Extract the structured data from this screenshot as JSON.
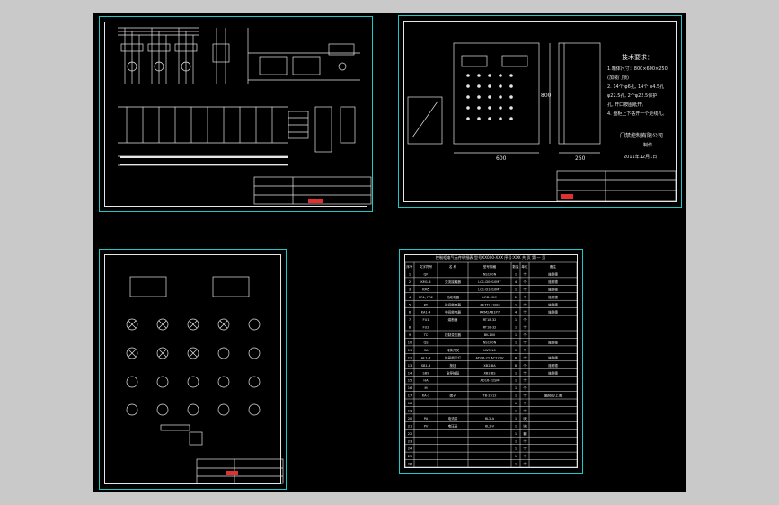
{
  "colors": {
    "background": "#c9c9c9",
    "canvas": "#000000",
    "sheet_border": "#1fc7c7",
    "line": "#e6e6e6",
    "accent_red": "#e03030"
  },
  "sheet2": {
    "notes_title": "技术要求：",
    "notes": [
      "1.箱体尺寸：800×600×250",
      "  (加装门锁)",
      "2. 14个 φ6孔, 14个 φ4.5孔",
      "  φ22.5孔, 2个φ22.5保护",
      "  孔, 开口按图纸开。",
      "4. 盘柜上下各开一个走线孔。"
    ],
    "company": "门禁控制有限公司",
    "author": "制作",
    "date": "2011年12月1日",
    "dim_width": "600",
    "dim_height": "800",
    "dim_depth": "250"
  },
  "sheet4": {
    "title": "控制柜电气元件明细表 型号XX000-XXX 序号:XXX 共 页 第 一 页",
    "header": [
      "序号",
      "文字符号",
      "名 称",
      "型号规格",
      "数量",
      "单位",
      "备注"
    ],
    "rows": [
      [
        "1",
        "QF",
        "",
        "NS100N",
        "1",
        "个",
        "施耐德"
      ],
      [
        "2",
        "KM1-4",
        "交流接触器",
        "LC1-D0910M7",
        "4",
        "个",
        "施耐德"
      ],
      [
        "3",
        "KM5",
        "",
        "LC1-D1810M7",
        "1",
        "个",
        "施耐德"
      ],
      [
        "4",
        "FR1, FR2",
        "热继电器",
        "LRD-22C",
        "2",
        "个",
        "施耐德"
      ],
      [
        "5",
        "KT",
        "时间继电器",
        "RE7TL11BU",
        "1",
        "个",
        "施耐德"
      ],
      [
        "6",
        "KA1-4",
        "中间继电器",
        "RXM2AB1P7",
        "4",
        "个",
        "施耐德"
      ],
      [
        "7",
        "FU1",
        "熔断器",
        "RT18-32",
        "1",
        "个",
        ""
      ],
      [
        "8",
        "FU2",
        "",
        "RT18-32",
        "1",
        "个",
        ""
      ],
      [
        "9",
        "TC",
        "控制变压器",
        "BK-100",
        "1",
        "个",
        ""
      ],
      [
        "10",
        "QS",
        "",
        "NS100N",
        "1",
        "个",
        "施耐德"
      ],
      [
        "11",
        "SA",
        "转换开关",
        "LW5-16",
        "1",
        "个",
        ""
      ],
      [
        "12",
        "HL1-8",
        "信号指示灯",
        "AD16-22 AC220V",
        "8",
        "个",
        "施耐德"
      ],
      [
        "13",
        "SB1-8",
        "按钮",
        "XB2-BA",
        "8",
        "个",
        "施耐德"
      ],
      [
        "14",
        "SB9",
        "急停按钮",
        "XB2-BS",
        "1",
        "个",
        "施耐德"
      ],
      [
        "15",
        "HA",
        "",
        "AD16-22SM",
        "1",
        "个",
        ""
      ],
      [
        "16",
        "M",
        "",
        "",
        "1",
        "个",
        ""
      ],
      [
        "17",
        "KA-1",
        "端子",
        "TB-2512",
        "1",
        "个",
        "施耐德/上海"
      ],
      [
        "18",
        "",
        "",
        "",
        "1",
        "个",
        ""
      ],
      [
        "19",
        "",
        "",
        "",
        "1",
        "个",
        ""
      ],
      [
        "20",
        "PA",
        "电流表",
        "6L2-A",
        "1",
        "块",
        ""
      ],
      [
        "21",
        "PV",
        "电压表",
        "6L2-V",
        "1",
        "块",
        ""
      ],
      [
        "22",
        "",
        "",
        "",
        "1",
        "套",
        ""
      ],
      [
        "23",
        "",
        "",
        "",
        "1",
        "个",
        ""
      ],
      [
        "24",
        "",
        "",
        "",
        "1",
        "个",
        ""
      ],
      [
        "25",
        "",
        "",
        "",
        "1",
        "个",
        ""
      ],
      [
        "26",
        "",
        "",
        "",
        "1",
        "个",
        ""
      ]
    ]
  }
}
